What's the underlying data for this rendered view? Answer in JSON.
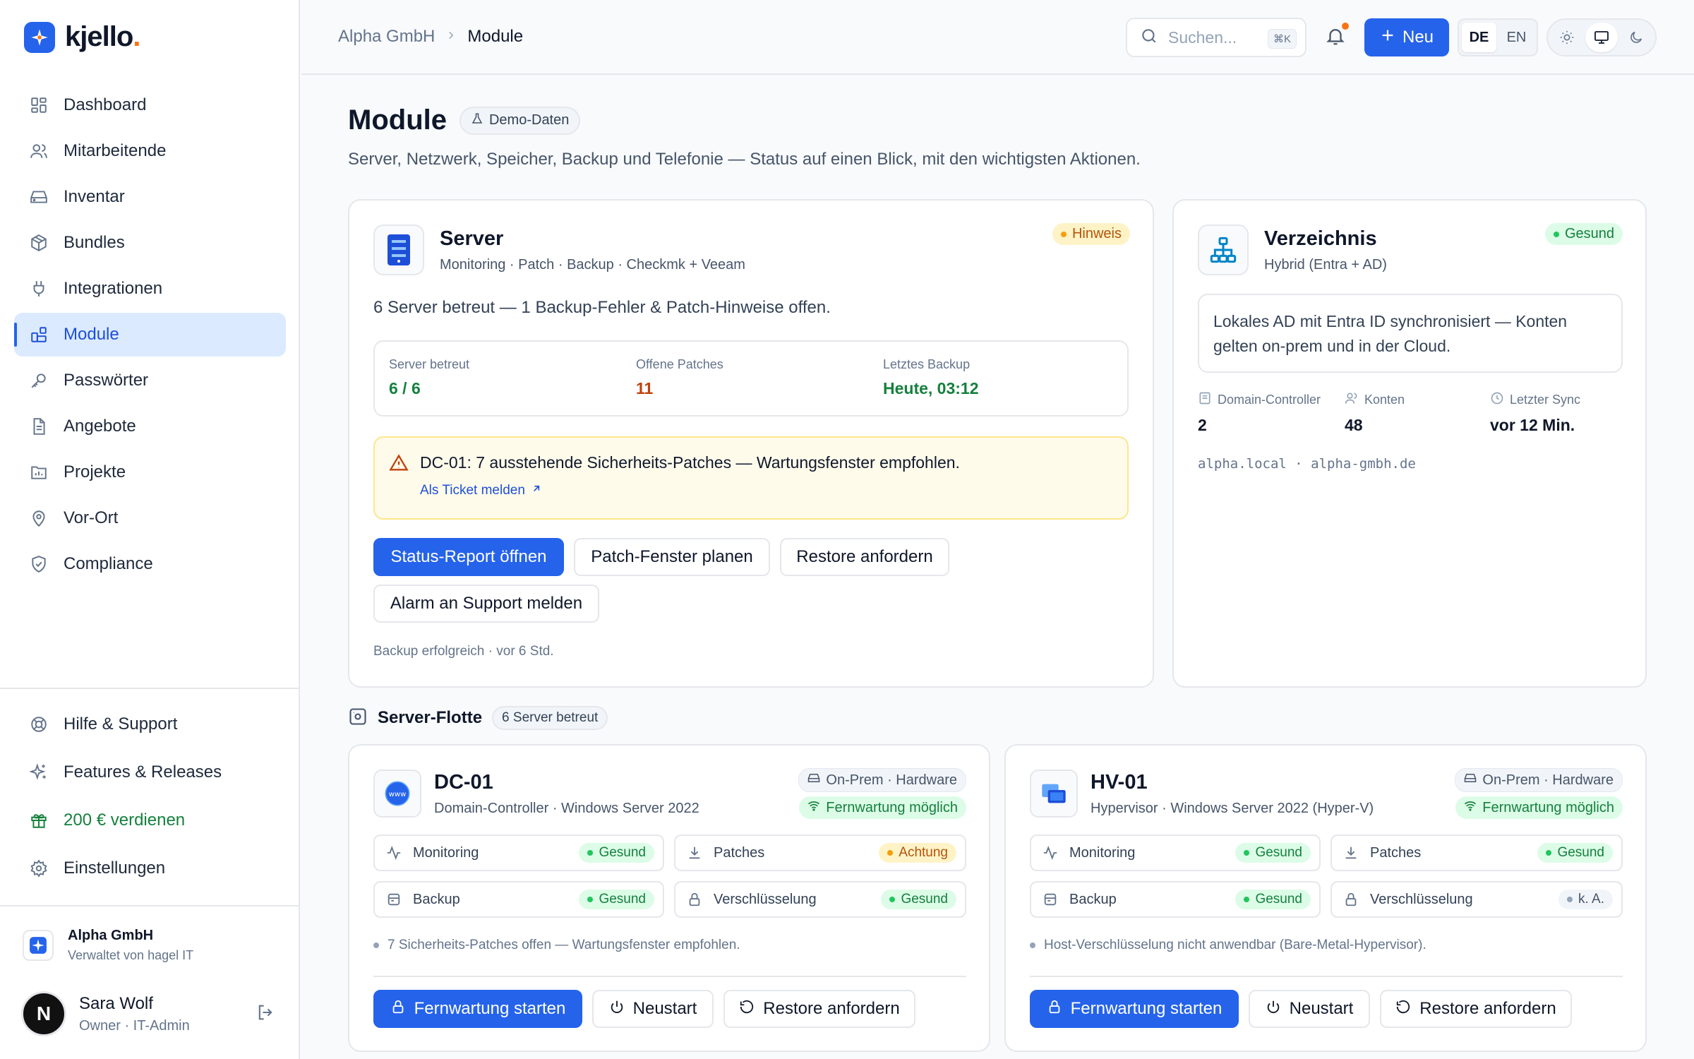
{
  "app": {
    "name": "kjello",
    "dot": "."
  },
  "sidebar": {
    "items": [
      {
        "label": "Dashboard"
      },
      {
        "label": "Mitarbeitende"
      },
      {
        "label": "Inventar"
      },
      {
        "label": "Bundles"
      },
      {
        "label": "Integrationen"
      },
      {
        "label": "Module"
      },
      {
        "label": "Passwörter"
      },
      {
        "label": "Angebote"
      },
      {
        "label": "Projekte"
      },
      {
        "label": "Vor-Ort"
      },
      {
        "label": "Compliance"
      }
    ],
    "bottom": [
      {
        "label": "Hilfe & Support"
      },
      {
        "label": "Features & Releases"
      },
      {
        "label": "200 € verdienen"
      },
      {
        "label": "Einstellungen"
      }
    ],
    "tenant": {
      "name": "Alpha GmbH",
      "sub": "Verwaltet von hagel IT"
    },
    "user": {
      "initial": "N",
      "name": "Sara Wolf",
      "role": "Owner · IT-Admin"
    }
  },
  "topbar": {
    "breadcrumb": [
      "Alpha GmbH",
      "Module"
    ],
    "search_placeholder": "Suchen...",
    "search_kbd": "⌘K",
    "new_label": "Neu",
    "lang": [
      "DE",
      "EN"
    ]
  },
  "page": {
    "title": "Module",
    "demo_badge": "Demo-Daten",
    "subtitle": "Server, Netzwerk, Speicher, Backup und Telefonie — Status auf einen Blick, mit den wichtigsten Aktionen."
  },
  "server_card": {
    "title": "Server",
    "sub": "Monitoring · Patch · Backup · Checkmk + Veeam",
    "status": "Hinweis",
    "summary": "6 Server betreut — 1 Backup-Fehler & Patch-Hinweise offen.",
    "stats": [
      {
        "label": "Server betreut",
        "value": "6 / 6"
      },
      {
        "label": "Offene Patches",
        "value": "11"
      },
      {
        "label": "Letztes Backup",
        "value": "Heute, 03:12"
      }
    ],
    "alert_text": "DC-01: 7 ausstehende Sicherheits-Patches — Wartungsfenster empfohlen.",
    "alert_link": "Als Ticket melden",
    "actions": [
      "Status-Report öffnen",
      "Patch-Fenster planen",
      "Restore anfordern",
      "Alarm an Support melden"
    ],
    "footer": "Backup erfolgreich · vor 6 Std."
  },
  "directory_card": {
    "title": "Verzeichnis",
    "sub": "Hybrid (Entra + AD)",
    "status": "Gesund",
    "description": "Lokales AD mit Entra ID synchronisiert — Konten gelten on-prem und in der Cloud.",
    "stats": [
      {
        "label": "Domain-Controller",
        "value": "2"
      },
      {
        "label": "Konten",
        "value": "48"
      },
      {
        "label": "Letzter Sync",
        "value": "vor 12 Min."
      }
    ],
    "domains": "alpha.local · alpha-gmbh.de"
  },
  "fleet": {
    "title": "Server-Flotte",
    "count": "6 Server betreut",
    "servers": [
      {
        "name": "DC-01",
        "sub": "Domain-Controller · Windows Server 2022",
        "location": "On-Prem · Hardware",
        "remote": "Fernwartung möglich",
        "checks": [
          {
            "label": "Monitoring",
            "status": "Gesund"
          },
          {
            "label": "Patches",
            "status": "Achtung"
          },
          {
            "label": "Backup",
            "status": "Gesund"
          },
          {
            "label": "Verschlüsselung",
            "status": "Gesund"
          }
        ],
        "note": "7 Sicherheits-Patches offen — Wartungsfenster empfohlen.",
        "actions": [
          "Fernwartung starten",
          "Neustart",
          "Restore anfordern"
        ]
      },
      {
        "name": "HV-01",
        "sub": "Hypervisor · Windows Server 2022 (Hyper-V)",
        "location": "On-Prem · Hardware",
        "remote": "Fernwartung möglich",
        "checks": [
          {
            "label": "Monitoring",
            "status": "Gesund"
          },
          {
            "label": "Patches",
            "status": "Gesund"
          },
          {
            "label": "Backup",
            "status": "Gesund"
          },
          {
            "label": "Verschlüsselung",
            "status": "k. A."
          }
        ],
        "note": "Host-Verschlüsselung nicht anwendbar (Bare-Metal-Hypervisor).",
        "actions": [
          "Fernwartung starten",
          "Neustart",
          "Restore anfordern"
        ]
      }
    ]
  },
  "colors": {
    "accent": "#2563eb",
    "ok": "#15803d",
    "warn": "#b45309",
    "brand_dot": "#f97316"
  }
}
